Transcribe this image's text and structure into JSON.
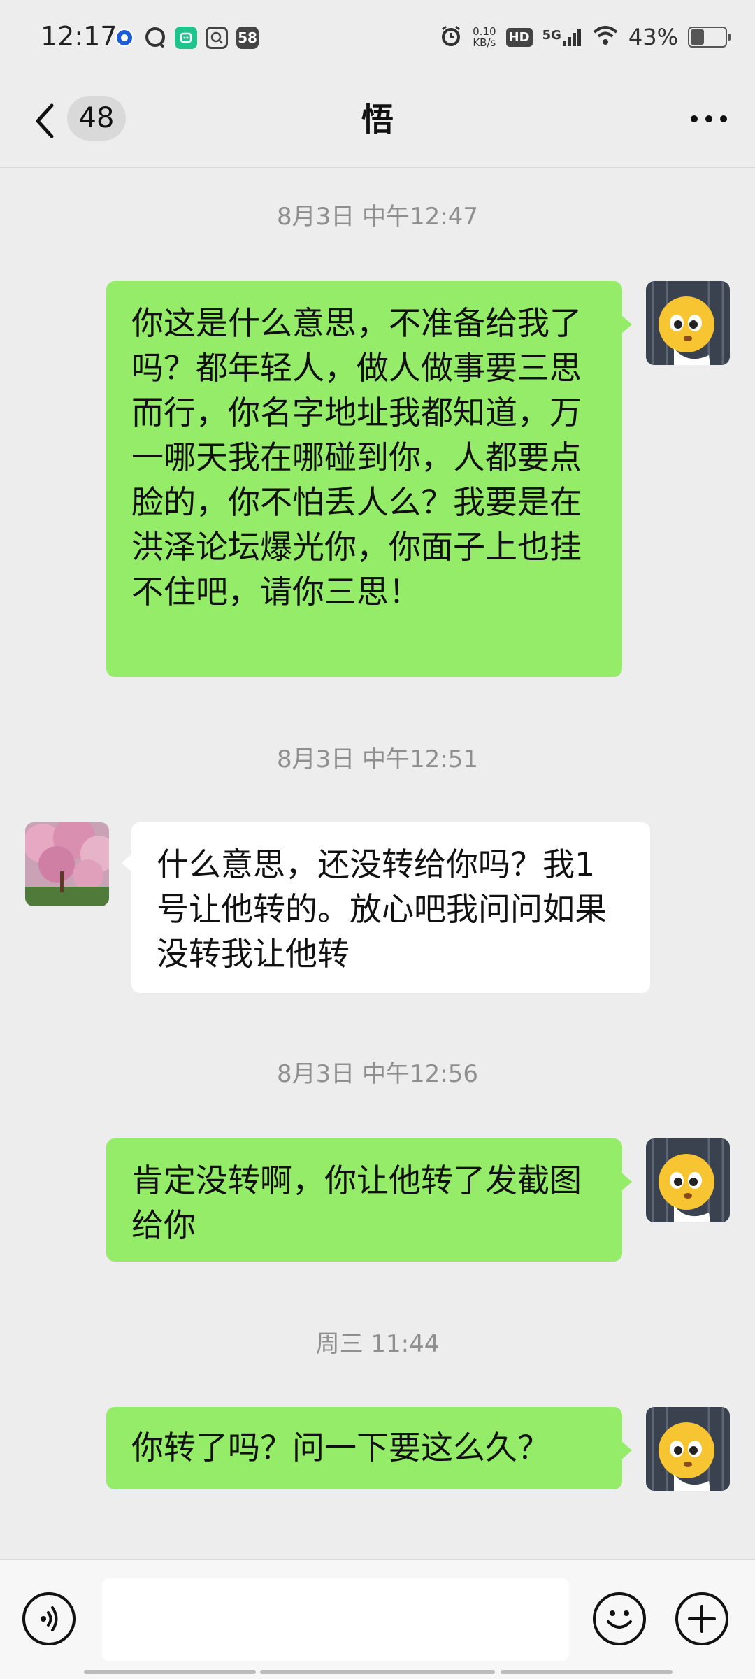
{
  "status_bar": {
    "time": "12:17",
    "net_speed_value": "0.10",
    "net_speed_unit": "KB/s",
    "hd": "HD",
    "signal": "5G",
    "battery": "43%",
    "battery_level": 0.43,
    "app_icons": [
      "browser-icon",
      "chat-bubble-icon",
      "mi-icon",
      "search-app-icon",
      "58-app-icon"
    ],
    "app_58_label": "58"
  },
  "header": {
    "unread_count": "48",
    "title": "悟"
  },
  "messages": [
    {
      "type": "timestamp",
      "text": "8月3日 中午12:47"
    },
    {
      "type": "sent",
      "text": "你这是什么意思，不准备给我了吗？都年轻人，做人做事要三思而行，你名字地址我都知道，万一哪天我在哪碰到你，人都要点脸的，你不怕丢人么？我要是在洪泽论坛爆光你，你面子上也挂不住吧，请你三思！"
    },
    {
      "type": "timestamp",
      "text": "8月3日 中午12:51"
    },
    {
      "type": "received",
      "text": "什么意思，还没转给你吗？我1号让他转的。放心吧我问问如果没转我让他转"
    },
    {
      "type": "timestamp",
      "text": "8月3日 中午12:56"
    },
    {
      "type": "sent",
      "text": "肯定没转啊，你让他转了发截图给你"
    },
    {
      "type": "timestamp",
      "text": "周三 11:44"
    },
    {
      "type": "sent",
      "text": "你转了吗？问一下要这么久？"
    }
  ],
  "input_bar": {
    "value": "",
    "icons": [
      "voice-icon",
      "emoji-icon",
      "plus-icon"
    ]
  },
  "colors": {
    "background": "#ededed",
    "sent_bubble": "#95ec69",
    "received_bubble": "#ffffff",
    "timestamp_text": "#8f8f8f"
  }
}
